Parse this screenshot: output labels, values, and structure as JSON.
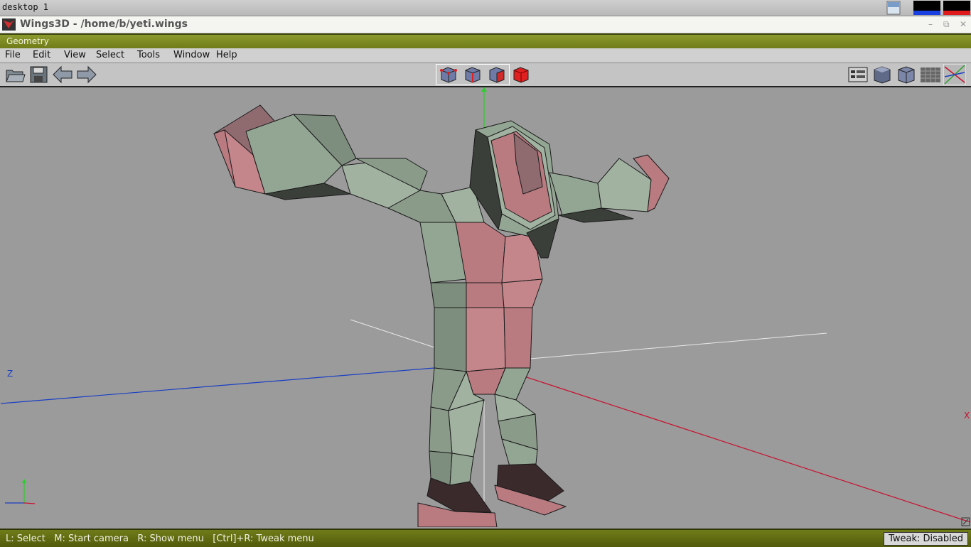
{
  "desktop": {
    "label": "desktop 1"
  },
  "window": {
    "title": "Wings3D - /home/b/yeti.wings",
    "controls": [
      "minimize-icon",
      "restore-icon",
      "close-icon"
    ]
  },
  "geometry_bar": {
    "title": "Geometry"
  },
  "menu": {
    "items": [
      "File",
      "Edit",
      "View",
      "Select",
      "Tools",
      "Window",
      "Help"
    ]
  },
  "toolbar": {
    "left_icons": [
      "open-folder-icon",
      "save-disk-icon",
      "undo-arrow-icon",
      "redo-arrow-icon"
    ],
    "selection_modes": [
      "vertex-mode-icon",
      "edge-mode-icon",
      "face-mode-icon",
      "body-mode-icon"
    ],
    "right_icons": [
      "outliner-icon",
      "smooth-shade-icon",
      "flat-shade-icon",
      "ground-grid-icon",
      "show-axes-icon"
    ]
  },
  "viewport": {
    "axis_labels": {
      "z": "Z",
      "x": "X"
    }
  },
  "status": {
    "hint": "L: Select   M: Start camera   R: Show menu   [Ctrl]+R: Tweak menu",
    "tweak": "Tweak: Disabled"
  },
  "colors": {
    "accent_green": "#7b8a20",
    "mesh_light": "#93a593",
    "mesh_red": "#b97a80",
    "axis_x": "#c8102e",
    "axis_y": "#29d029",
    "axis_z": "#1a3fc4"
  }
}
